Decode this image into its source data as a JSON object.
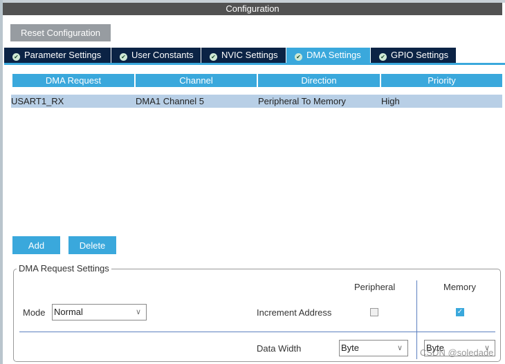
{
  "window": {
    "title": "Configuration"
  },
  "toolbar": {
    "reset_label": "Reset Configuration"
  },
  "tabs": [
    {
      "label": "Parameter Settings",
      "active": false
    },
    {
      "label": "User Constants",
      "active": false
    },
    {
      "label": "NVIC Settings",
      "active": false
    },
    {
      "label": "DMA Settings",
      "active": true
    },
    {
      "label": "GPIO Settings",
      "active": false
    }
  ],
  "table": {
    "headers": [
      "DMA Request",
      "Channel",
      "Direction",
      "Priority"
    ],
    "rows": [
      [
        "USART1_RX",
        "DMA1 Channel 5",
        "Peripheral To Memory",
        "High"
      ]
    ]
  },
  "actions": {
    "add": "Add",
    "delete": "Delete"
  },
  "settings": {
    "legend": "DMA Request Settings",
    "peripheral_header": "Peripheral",
    "memory_header": "Memory",
    "mode_label": "Mode",
    "mode_value": "Normal",
    "increment_label": "Increment Address",
    "peripheral_increment": false,
    "memory_increment": true,
    "data_width_label": "Data Width",
    "peripheral_width": "Byte",
    "memory_width": "Byte"
  },
  "watermark": "CSDN @soledade",
  "colors": {
    "accent": "#3aa8dc",
    "tab_dark": "#0b2345",
    "selected_row": "#b8cfe6"
  }
}
